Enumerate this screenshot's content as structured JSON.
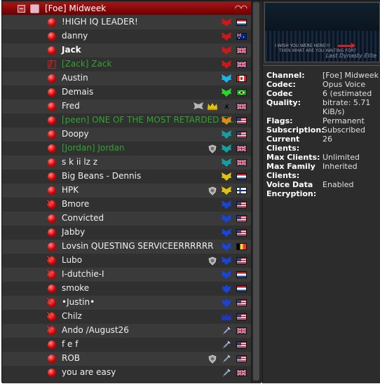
{
  "channel": {
    "name": "[Foe] Midweek",
    "header_glyph": "◠◠"
  },
  "clients": [
    {
      "name": "!HIGH IQ LEADER!",
      "style": "plain",
      "status": "talk",
      "rank": "red-wings-icon",
      "rank_color": "#cc1818",
      "flag": "nl"
    },
    {
      "name": "danny",
      "style": "plain",
      "status": "talk",
      "rank": "red-wings-icon",
      "rank_color": "#cc1818",
      "flag": "au"
    },
    {
      "name": "Jack",
      "style": "bold",
      "status": "talk",
      "rank": "red-wings-icon",
      "rank_color": "#cc1818",
      "flag": "gb"
    },
    {
      "name": "[Zack] Zack",
      "style": "green",
      "status": "away",
      "rank": "red-wings-icon",
      "rank_color": "#cc1818",
      "flag": "gb"
    },
    {
      "name": "Austin",
      "style": "plain",
      "status": "talk",
      "rank": "cyan-wings-icon",
      "rank_color": "#18b8e0",
      "flag": "ca"
    },
    {
      "name": "Demais",
      "style": "plain",
      "status": "talk",
      "rank": "green-wings-icon",
      "rank_color": "#28d828",
      "flag": "br"
    },
    {
      "name": "Fred",
      "style": "plain",
      "status": "talk",
      "rank": "black-wings-icon",
      "rank_color": "#111111",
      "flag": "gb",
      "extra": [
        "silver-wings-icon",
        "gold-crown-icon"
      ]
    },
    {
      "name": "[peen] ONE OF THE MOST RETARDED EL...",
      "style": "green",
      "status": "talk",
      "rank": "orange-wings-icon",
      "rank_color": "#e08a18",
      "flag": "us"
    },
    {
      "name": "Doopy",
      "style": "plain",
      "status": "talk",
      "rank": "teal-wings-icon",
      "rank_color": "#14a0a0",
      "flag": "us"
    },
    {
      "name": "[Jordan] Jordan",
      "style": "green",
      "status": "talk",
      "rank": "teal-wings-icon",
      "rank_color": "#14a0a0",
      "flag": "gb",
      "shield": true
    },
    {
      "name": "s k ii lz z",
      "style": "plain",
      "status": "talk",
      "rank": "teal-wings-icon",
      "rank_color": "#14a0a0",
      "flag": "gb"
    },
    {
      "name": "Big Beans - Dennis",
      "style": "plain",
      "status": "talk",
      "rank": "yellow-wings-icon",
      "rank_color": "#e0c010",
      "flag": "nl"
    },
    {
      "name": "HPK",
      "style": "plain",
      "status": "talk",
      "rank": "yellow-wings-icon",
      "rank_color": "#e0c010",
      "flag": "fi",
      "shield": true
    },
    {
      "name": "Bmore",
      "style": "plain",
      "status": "muted",
      "rank": "blue-wings-icon",
      "rank_color": "#1844d8",
      "flag": "us"
    },
    {
      "name": "Convicted",
      "style": "plain",
      "status": "talk",
      "rank": "blue-wings-icon",
      "rank_color": "#1844d8",
      "flag": "us"
    },
    {
      "name": "Jabby",
      "style": "plain",
      "status": "talk",
      "rank": "blue-wings-icon",
      "rank_color": "#1844d8",
      "flag": "us"
    },
    {
      "name": "Lovsin QUESTING SERVICEERRRRRR",
      "style": "plain",
      "status": "talk",
      "rank": "blue-wings-icon",
      "rank_color": "#1844d8",
      "flag": "be"
    },
    {
      "name": "Lubo",
      "style": "plain",
      "status": "muted",
      "rank": "blue-wings-icon",
      "rank_color": "#1844d8",
      "flag": "us",
      "shield": true
    },
    {
      "name": "I-dutchie-I",
      "style": "plain",
      "status": "muted",
      "rank": "blue-wings-icon",
      "rank_color": "#1844d8",
      "flag": "nl"
    },
    {
      "name": "smoke",
      "style": "plain",
      "status": "talk",
      "rank": "blue-crest-icon",
      "rank_color": "#1844d8",
      "flag": "nl"
    },
    {
      "name": "•Justin•",
      "style": "plain",
      "status": "muted",
      "rank": "blue-crest-icon",
      "rank_color": "#1844d8",
      "flag": "us"
    },
    {
      "name": "Chilz",
      "style": "plain",
      "status": "muted",
      "rank": "blue-crown-icon",
      "rank_color": "#2038b8",
      "flag": "us"
    },
    {
      "name": "Ando /August26",
      "style": "plain",
      "status": "muted",
      "rank": "sword-icon",
      "rank_color": "#8aa0c8",
      "flag": "gb"
    },
    {
      "name": "f e f",
      "style": "plain",
      "status": "talk",
      "rank": "sword-icon",
      "rank_color": "#8aa0c8",
      "flag": "us"
    },
    {
      "name": "ROB",
      "style": "plain",
      "status": "talk",
      "rank": "sword-icon",
      "rank_color": "#8aa0c8",
      "flag": "us",
      "shield": true
    },
    {
      "name": "you are easy",
      "style": "plain",
      "status": "talk",
      "rank": "sword-icon",
      "rank_color": "#8aa0c8",
      "flag": "gb"
    }
  ],
  "banner": {
    "caption_line1": "I WISH YOU WERE HERE!!!",
    "caption_line2": "THEN WHAT ARE YOU WAITING FOR?",
    "brand": "Last Dynasty Elite"
  },
  "info": [
    {
      "key": "Channel:",
      "value": "[Foe] Midweek"
    },
    {
      "key": "Codec:",
      "value": "Opus Voice"
    },
    {
      "key": "Codec Quality:",
      "value": "6 (estimated bitrate: 5.71 KiB/s)"
    },
    {
      "key": "Flags:",
      "value": "Permanent"
    },
    {
      "key": "Subscription:",
      "value": "Subscribed"
    },
    {
      "key": "Current Clients:",
      "value": "26"
    },
    {
      "key": "Max Clients:",
      "value": "Unlimited"
    },
    {
      "key": "Max Family Clients:",
      "value": "Inherited"
    },
    {
      "key": "Voice Data Encryption:",
      "value": "Enabled"
    }
  ],
  "colors": {
    "talk_status": "#d80000",
    "green_name": "#2fa52f",
    "channel_bar": "#a81414"
  }
}
